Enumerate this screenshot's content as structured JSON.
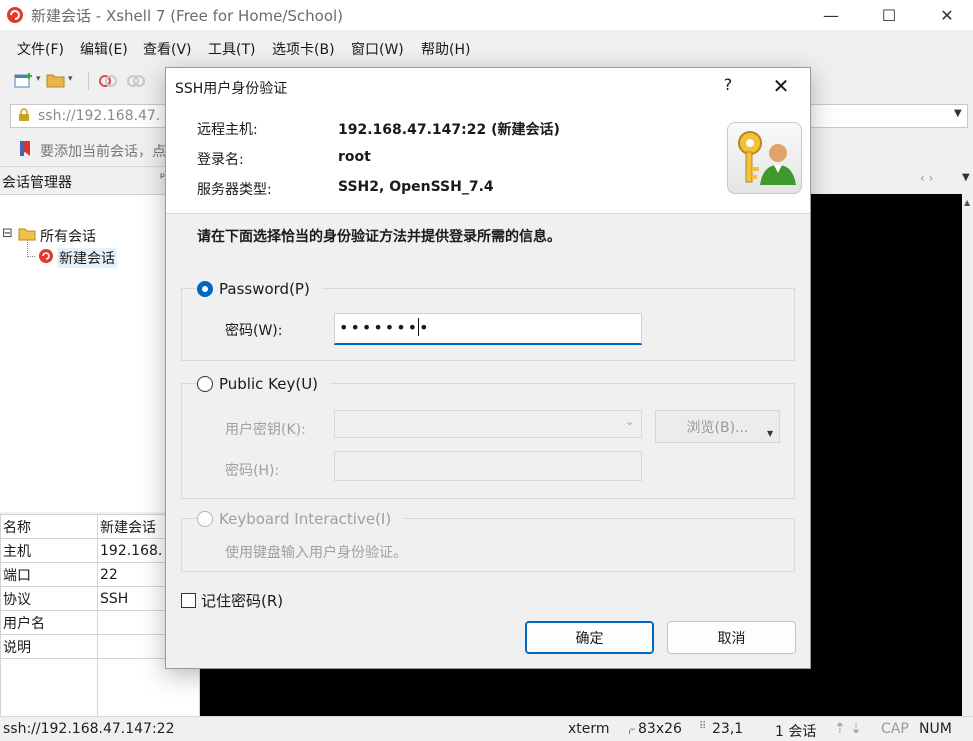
{
  "window": {
    "title": "新建会话 - Xshell 7 (Free for Home/School)",
    "minimize_icon": "minimize-icon",
    "maximize_icon": "maximize-icon",
    "close_icon": "close-icon"
  },
  "menu": [
    "文件(F)",
    "编辑(E)",
    "查看(V)",
    "工具(T)",
    "选项卡(B)",
    "窗口(W)",
    "帮助(H)"
  ],
  "address_bar": {
    "value": "ssh://192.168.47."
  },
  "hint_bar": {
    "text": "要添加当前会话，点"
  },
  "session_manager": {
    "title": "会话管理器",
    "pin": "ᵖ",
    "tree": {
      "root": "所有会话",
      "child": "新建会话",
      "expand_glyph": "⊟"
    }
  },
  "properties": [
    {
      "name": "名称",
      "value": "新建会话"
    },
    {
      "name": "主机",
      "value": "192.168."
    },
    {
      "name": "端口",
      "value": "22"
    },
    {
      "name": "协议",
      "value": "SSH"
    },
    {
      "name": "用户名",
      "value": ""
    },
    {
      "name": "说明",
      "value": ""
    }
  ],
  "status_bar": {
    "address": "ssh://192.168.47.147:22",
    "term": "xterm",
    "size_glyph": "⌌",
    "size": "83x26",
    "pos_glyph": "⠿",
    "position": "23,1",
    "sessions": "1 会话",
    "arrows": "⇡ ⇣",
    "cap": "CAP",
    "num": "NUM"
  },
  "dialog": {
    "title": "SSH用户身份验证",
    "help": "?",
    "close": "✕",
    "info": {
      "remote_host_label": "远程主机:",
      "remote_host_value": "192.168.47.147:22 (新建会话)",
      "login_label": "登录名:",
      "login_value": "root",
      "server_type_label": "服务器类型:",
      "server_type_value": "SSH2, OpenSSH_7.4"
    },
    "instruction": "请在下面选择恰当的身份验证方法并提供登录所需的信息。",
    "password_method": {
      "label": "Password(P)",
      "field_label": "密码(W):",
      "value": "••••••••"
    },
    "public_key_method": {
      "label": "Public Key(U)",
      "user_key_label": "用户密钥(K):",
      "browse": "浏览(B)...",
      "passphrase_label": "密码(H):"
    },
    "keyboard_method": {
      "label": "Keyboard Interactive(I)",
      "description": "使用键盘输入用户身份验证。"
    },
    "remember_password": "记住密码(R)",
    "ok": "确定",
    "cancel": "取消"
  }
}
